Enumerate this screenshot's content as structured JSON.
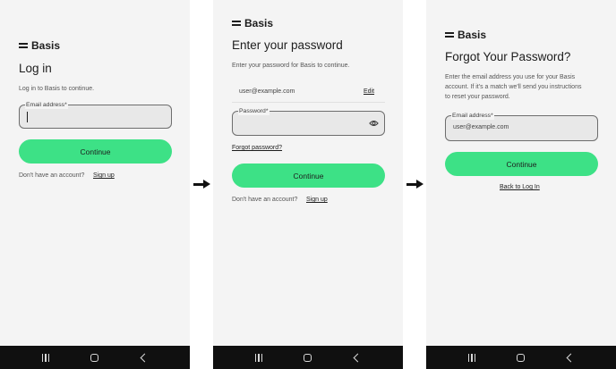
{
  "brand": {
    "name": "Basis"
  },
  "screens": [
    {
      "heading": "Log in",
      "subtext": "Log in to Basis to continue.",
      "email_label": "Email address*",
      "continue_label": "Continue",
      "no_account_text": "Don't have an account?",
      "signup_label": "Sign up"
    },
    {
      "heading": "Enter your password",
      "subtext": "Enter your password for Basis to continue.",
      "email_value": "user@example.com",
      "edit_label": "Edit",
      "password_label": "Password*",
      "forgot_label": "Forgot password?",
      "continue_label": "Continue",
      "no_account_text": "Don't have an account?",
      "signup_label": "Sign up"
    },
    {
      "heading": "Forgot Your Password?",
      "subtext_lines": [
        "Enter the email address you use for your Basis",
        "account. If it's a match we'll send you instructions",
        "to reset your password."
      ],
      "email_label": "Email address*",
      "email_value": "user@example.com",
      "continue_label": "Continue",
      "back_label": "Back to Log In"
    }
  ],
  "colors": {
    "accent": "#3de186",
    "screen_bg": "#f4f4f4",
    "navbar_bg": "#101010",
    "field_bg": "#e8e8e8"
  },
  "icons": [
    "eye-icon",
    "arrow-right-icon",
    "recents-icon",
    "home-icon",
    "back-icon"
  ]
}
